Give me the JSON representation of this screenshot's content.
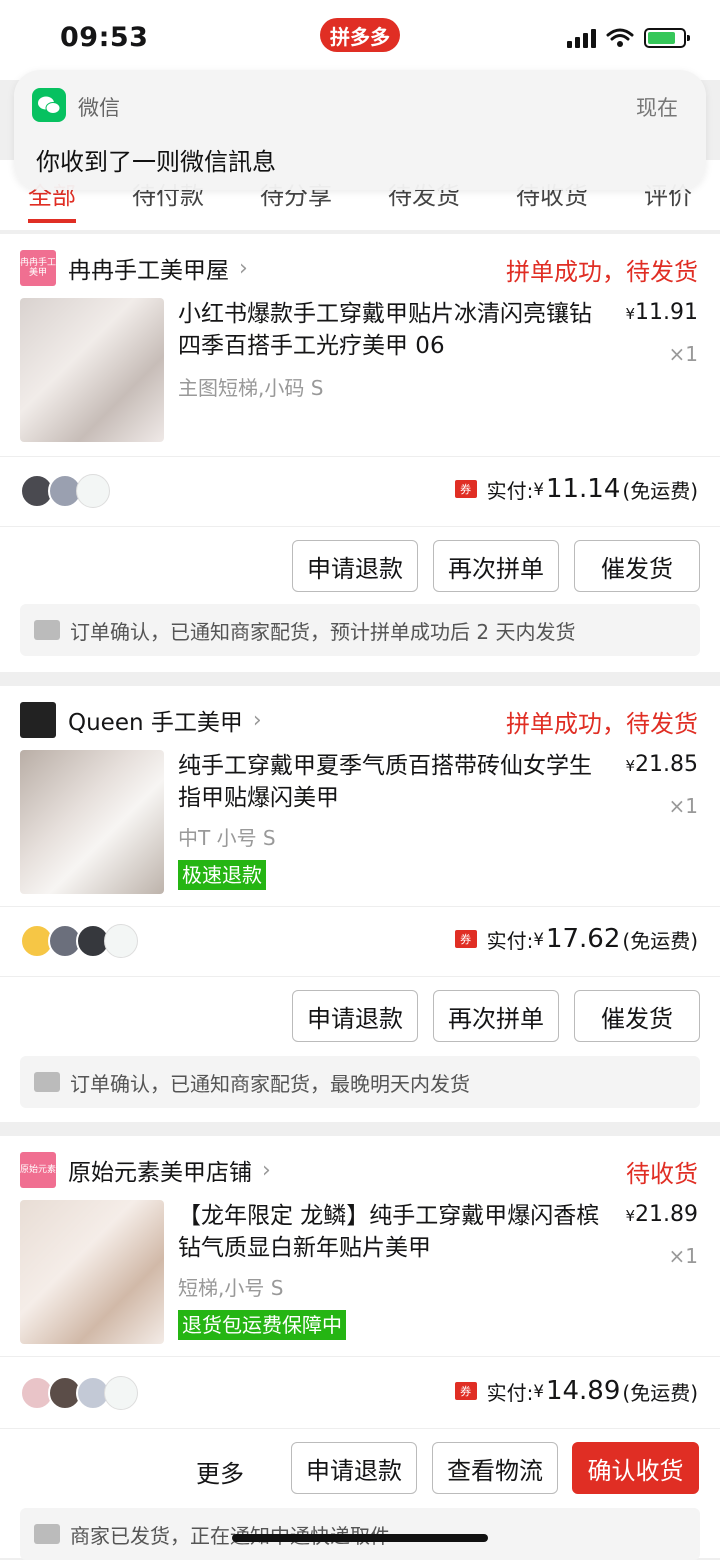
{
  "status_bar": {
    "time": "09:53",
    "app_pill": "拼多多"
  },
  "notification": {
    "app": "微信",
    "time": "现在",
    "message": "你收到了一则微信訊息"
  },
  "tabs": [
    {
      "label": "全部"
    },
    {
      "label": "待付款"
    },
    {
      "label": "待分享"
    },
    {
      "label": "待发货"
    },
    {
      "label": "待收货"
    },
    {
      "label": "评价"
    }
  ],
  "orders": [
    {
      "shop": "冉冉手工美甲屋",
      "shop_logo_text": "冉冉手工美甲",
      "status": "拼单成功，待发货",
      "title": "小红书爆款手工穿戴甲贴片冰清闪亮镶钻四季百搭手工光疗美甲 06",
      "price_symbol": "¥",
      "price": "11.91",
      "qty": "×1",
      "spec": "主图短梯,小码 S",
      "paid_label": "实付:",
      "paid_symbol": "¥",
      "paid_amount": "11.14",
      "paid_note": "(免运费)",
      "coupon": "券",
      "buttons": [
        "申请退款",
        "再次拼单",
        "催发货"
      ],
      "info": "订单确认，已通知商家配货，预计拼单成功后 2 天内发货"
    },
    {
      "shop": "Queen 手工美甲",
      "status": "拼单成功，待发货",
      "title": "纯手工穿戴甲夏季气质百搭带砖仙女学生指甲贴爆闪美甲",
      "price_symbol": "¥",
      "price": "21.85",
      "qty": "×1",
      "spec": "中T  小号 S",
      "tag": "极速退款",
      "paid_label": "实付:",
      "paid_symbol": "¥",
      "paid_amount": "17.62",
      "paid_note": "(免运费)",
      "coupon": "券",
      "buttons": [
        "申请退款",
        "再次拼单",
        "催发货"
      ],
      "info": "订单确认，已通知商家配货，最晚明天内发货"
    },
    {
      "shop": "原始元素美甲店铺",
      "shop_logo_text": "原始元素",
      "status": "待收货",
      "title": "【龙年限定 龙鳞】纯手工穿戴甲爆闪香槟钻气质显白新年贴片美甲",
      "price_symbol": "¥",
      "price": "21.89",
      "qty": "×1",
      "spec": "短梯,小号 S",
      "tag": "退货包运费保障中",
      "paid_label": "实付:",
      "paid_symbol": "¥",
      "paid_amount": "14.89",
      "paid_note": "(免运费)",
      "coupon": "券",
      "more": "更多",
      "buttons": [
        "申请退款",
        "查看物流",
        "确认收货"
      ],
      "info": "商家已发货，正在通知中通快递取件"
    }
  ],
  "colors": {
    "brand_red": "#e02e24",
    "tag_green": "#25b513",
    "wechat_green": "#07c160"
  }
}
